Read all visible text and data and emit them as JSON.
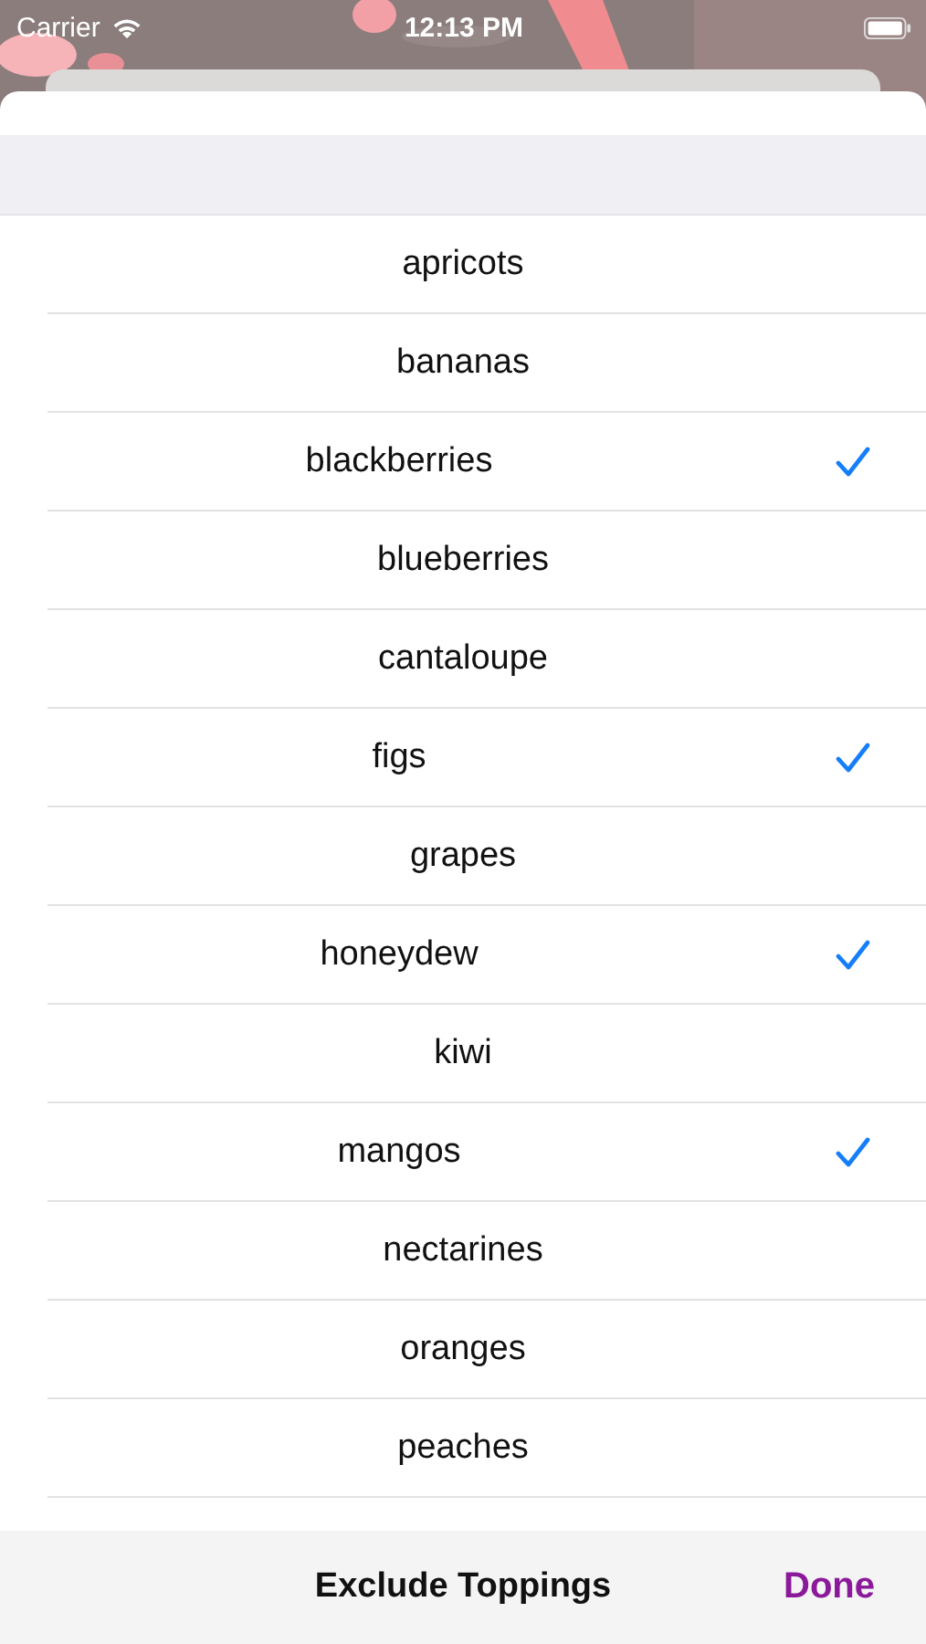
{
  "status_bar": {
    "carrier": "Carrier",
    "time": "12:13 PM"
  },
  "options": [
    {
      "label": "apricots",
      "checked": false
    },
    {
      "label": "bananas",
      "checked": false
    },
    {
      "label": "blackberries",
      "checked": true
    },
    {
      "label": "blueberries",
      "checked": false
    },
    {
      "label": "cantaloupe",
      "checked": false
    },
    {
      "label": "figs",
      "checked": true
    },
    {
      "label": "grapes",
      "checked": false
    },
    {
      "label": "honeydew",
      "checked": true
    },
    {
      "label": "kiwi",
      "checked": false
    },
    {
      "label": "mangos",
      "checked": true
    },
    {
      "label": "nectarines",
      "checked": false
    },
    {
      "label": "oranges",
      "checked": false
    },
    {
      "label": "peaches",
      "checked": false
    }
  ],
  "toolbar": {
    "title": "Exclude Toppings",
    "done": "Done"
  }
}
